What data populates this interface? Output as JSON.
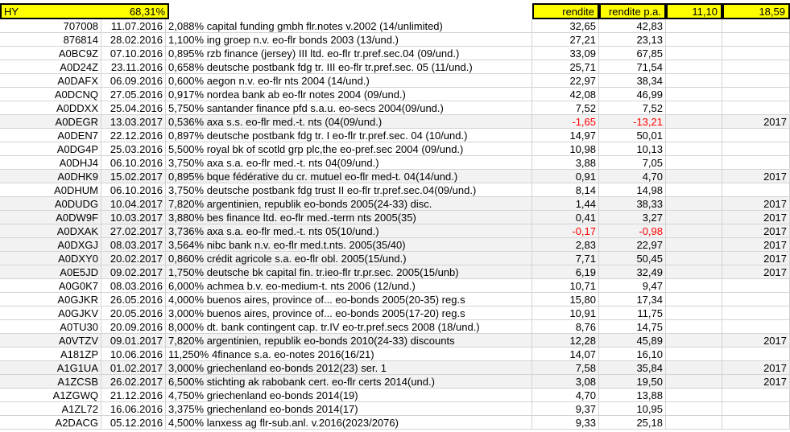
{
  "header": {
    "label": "HY",
    "percent": "68,31%",
    "rendite": "rendite",
    "rendite_pa": "rendite p.a.",
    "val1": "11,10",
    "val2": "18,59"
  },
  "colors": {
    "highlight": "#ffff00",
    "negative": "#ff0000",
    "shade": "#f2f2f2"
  },
  "rows": [
    {
      "code": "707008",
      "date": "11.07.2016",
      "desc": "2,088% capital funding gmbh flr.notes v.2002 (14/unlimited)",
      "r": "32,65",
      "rpa": "42,83",
      "year": "",
      "neg": false,
      "shade": false
    },
    {
      "code": "876814",
      "date": "28.02.2016",
      "desc": "1,100% ing groep n.v. eo-flr bonds 2003 (13/und.)",
      "r": "27,21",
      "rpa": "23,13",
      "year": "",
      "neg": false,
      "shade": false
    },
    {
      "code": "A0BC9Z",
      "date": "07.10.2016",
      "desc": "0,895% rzb finance (jersey) III ltd. eo-flr tr.pref.sec.04 (09/und.)",
      "r": "33,09",
      "rpa": "67,85",
      "year": "",
      "neg": false,
      "shade": false
    },
    {
      "code": "A0D24Z",
      "date": "23.11.2016",
      "desc": "0,658% deutsche postbank fdg tr. III eo-flr tr.pref.sec. 05 (11/und.)",
      "r": "25,71",
      "rpa": "71,54",
      "year": "",
      "neg": false,
      "shade": false
    },
    {
      "code": "A0DAFX",
      "date": "06.09.2016",
      "desc": "0,600% aegon n.v. eo-flr nts 2004 (14/und.)",
      "r": "22,97",
      "rpa": "38,34",
      "year": "",
      "neg": false,
      "shade": false
    },
    {
      "code": "A0DCNQ",
      "date": "27.05.2016",
      "desc": "0,917% nordea bank ab eo-flr notes 2004 (09/und.)",
      "r": "42,08",
      "rpa": "46,99",
      "year": "",
      "neg": false,
      "shade": false
    },
    {
      "code": "A0DDXX",
      "date": "25.04.2016",
      "desc": "5,750% santander finance pfd s.a.u. eo-secs 2004(09/und.)",
      "r": "7,52",
      "rpa": "7,52",
      "year": "",
      "neg": false,
      "shade": false
    },
    {
      "code": "A0DEGR",
      "date": "13.03.2017",
      "desc": "0,536% axa s.s. eo-flr med.-t. nts (04(09/und.)",
      "r": "-1,65",
      "rpa": "-13,21",
      "year": "2017",
      "neg": true,
      "shade": true
    },
    {
      "code": "A0DEN7",
      "date": "22.12.2016",
      "desc": "0,897% deutsche postbank fdg tr. I eo-flr tr.pref.sec. 04 (10/und.)",
      "r": "14,97",
      "rpa": "50,01",
      "year": "",
      "neg": false,
      "shade": false
    },
    {
      "code": "A0DG4P",
      "date": "25.03.2016",
      "desc": "5,500% royal bk of scotld grp plc,the eo-pref.sec 2004 (09/und.)",
      "r": "10,98",
      "rpa": "10,13",
      "year": "",
      "neg": false,
      "shade": false
    },
    {
      "code": "A0DHJ4",
      "date": "06.10.2016",
      "desc": "3,750% axa s.a. eo-flr med.-t. nts 04(09/und.)",
      "r": "3,88",
      "rpa": "7,05",
      "year": "",
      "neg": false,
      "shade": false
    },
    {
      "code": "A0DHK9",
      "date": "15.02.2017",
      "desc": "0,895% bque fédérative du cr. mutuel eo-flr med-t. 04(14/und.)",
      "r": "0,91",
      "rpa": "4,70",
      "year": "2017",
      "neg": false,
      "shade": true
    },
    {
      "code": "A0DHUM",
      "date": "06.10.2016",
      "desc": "3,750% deutsche postbank fdg trust II eo-flr tr.pref.sec.04(09/und.)",
      "r": "8,14",
      "rpa": "14,98",
      "year": "",
      "neg": false,
      "shade": false
    },
    {
      "code": "A0DUDG",
      "date": "10.04.2017",
      "desc": "7,820% argentinien, republik eo-bonds 2005(24-33) disc.",
      "r": "1,44",
      "rpa": "38,33",
      "year": "2017",
      "neg": false,
      "shade": true
    },
    {
      "code": "A0DW9F",
      "date": "10.03.2017",
      "desc": "3,880% bes finance ltd. eo-flr med.-term nts 2005(35)",
      "r": "0,41",
      "rpa": "3,27",
      "year": "2017",
      "neg": false,
      "shade": true
    },
    {
      "code": "A0DXAK",
      "date": "27.02.2017",
      "desc": "3,736% axa s.a. eo-flr med.-t. nts 05(10/und.)",
      "r": "-0,17",
      "rpa": "-0,98",
      "year": "2017",
      "neg": true,
      "shade": true
    },
    {
      "code": "A0DXGJ",
      "date": "08.03.2017",
      "desc": "3,564% nibc bank n.v. eo-flr med.t.nts. 2005(35/40)",
      "r": "2,83",
      "rpa": "22,97",
      "year": "2017",
      "neg": false,
      "shade": true
    },
    {
      "code": "A0DXY0",
      "date": "20.02.2017",
      "desc": "0,860% crédit agricole s.a. eo-flr obl. 2005(15/und.)",
      "r": "7,71",
      "rpa": "50,45",
      "year": "2017",
      "neg": false,
      "shade": true
    },
    {
      "code": "A0E5JD",
      "date": "09.02.2017",
      "desc": "1,750% deutsche bk capital fin. tr.ieo-flr tr.pr.sec. 2005(15/unb)",
      "r": "6,19",
      "rpa": "32,49",
      "year": "2017",
      "neg": false,
      "shade": true
    },
    {
      "code": "A0G0K7",
      "date": "08.03.2016",
      "desc": "6,000% achmea b.v. eo-medium-t. nts 2006 (12/und.)",
      "r": "10,71",
      "rpa": "9,47",
      "year": "",
      "neg": false,
      "shade": false
    },
    {
      "code": "A0GJKR",
      "date": "26.05.2016",
      "desc": "4,000% buenos aires, province of... eo-bonds 2005(20-35) reg.s",
      "r": "15,80",
      "rpa": "17,34",
      "year": "",
      "neg": false,
      "shade": false
    },
    {
      "code": "A0GJKV",
      "date": "20.05.2016",
      "desc": "3,000% buenos aires, province of... eo-bonds 2005(17-20) reg.s",
      "r": "10,91",
      "rpa": "11,75",
      "year": "",
      "neg": false,
      "shade": false
    },
    {
      "code": "A0TU30",
      "date": "20.09.2016",
      "desc": "8,000% dt. bank contingent cap. tr.IV eo-tr.pref.secs 2008 (18/und.)",
      "r": "8,76",
      "rpa": "14,75",
      "year": "",
      "neg": false,
      "shade": false
    },
    {
      "code": "A0VTZV",
      "date": "09.01.2017",
      "desc": "7,820% argentinien, republik eo-bonds 2010(24-33) discounts",
      "r": "12,28",
      "rpa": "45,89",
      "year": "2017",
      "neg": false,
      "shade": true
    },
    {
      "code": "A181ZP",
      "date": "10.06.2016",
      "desc": "11,250% 4finance s.a. eo-notes 2016(16/21)",
      "r": "14,07",
      "rpa": "16,10",
      "year": "",
      "neg": false,
      "shade": false
    },
    {
      "code": "A1G1UA",
      "date": "01.02.2017",
      "desc": "3,000% griechenland eo-bonds 2012(23) ser. 1",
      "r": "7,58",
      "rpa": "35,84",
      "year": "2017",
      "neg": false,
      "shade": true
    },
    {
      "code": "A1ZCSB",
      "date": "26.02.2017",
      "desc": "6,500% stichting ak rabobank cert. eo-flr certs 2014(und.)",
      "r": "3,08",
      "rpa": "19,50",
      "year": "2017",
      "neg": false,
      "shade": true
    },
    {
      "code": "A1ZGWQ",
      "date": "21.12.2016",
      "desc": "4,750% griechenland eo-bonds 2014(19)",
      "r": "4,70",
      "rpa": "13,88",
      "year": "",
      "neg": false,
      "shade": false
    },
    {
      "code": "A1ZL72",
      "date": "16.06.2016",
      "desc": "3,375% griechenland eo-bonds 2014(17)",
      "r": "9,37",
      "rpa": "10,95",
      "year": "",
      "neg": false,
      "shade": false
    },
    {
      "code": "A2DACG",
      "date": "05.12.2016",
      "desc": "4,500% lanxess ag flr-sub.anl. v.2016(2023/2076)",
      "r": "9,33",
      "rpa": "25,18",
      "year": "",
      "neg": false,
      "shade": false
    }
  ]
}
